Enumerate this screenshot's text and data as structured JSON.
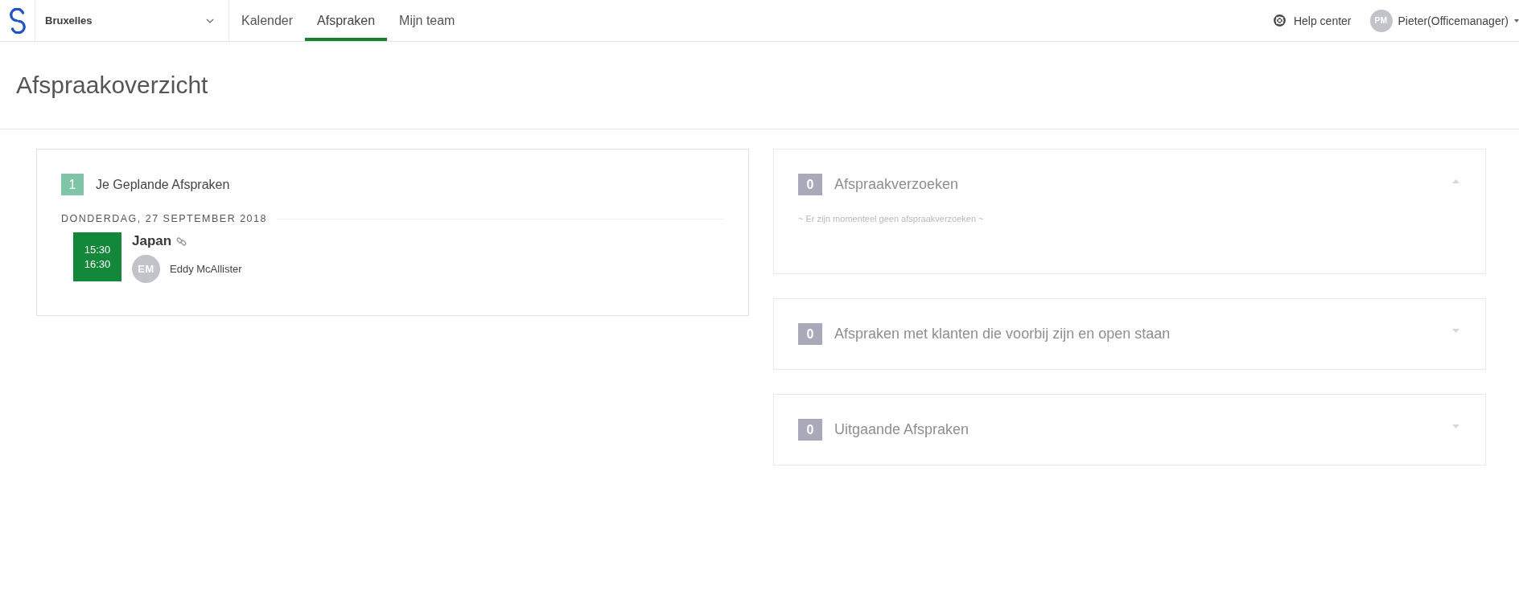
{
  "nav": {
    "location": "Bruxelles",
    "tabs": [
      {
        "label": "Kalender",
        "selected": false
      },
      {
        "label": "Afspraken",
        "selected": true
      },
      {
        "label": "Mijn team",
        "selected": false
      }
    ],
    "help": "Help center",
    "user": {
      "initials": "PM",
      "name": "Pieter(Officemanager)"
    }
  },
  "page_title": "Afspraakoverzicht",
  "planned": {
    "count": "1",
    "title": "Je Geplande Afspraken",
    "days": [
      {
        "date": "DONDERDAG, 27 SEPTEMBER 2018",
        "appointments": [
          {
            "start": "15:30",
            "end": "16:30",
            "title": "Japan",
            "attendee": {
              "initials": "EM",
              "name": "Eddy McAllister"
            }
          }
        ]
      }
    ]
  },
  "sections": [
    {
      "count": "0",
      "title": "Afspraakverzoeken",
      "expanded": true,
      "empty_message": "~ Er zijn momenteel geen afspraakverzoeken ~"
    },
    {
      "count": "0",
      "title": "Afspraken met klanten die voorbij zijn en open staan",
      "expanded": false
    },
    {
      "count": "0",
      "title": "Uitgaande Afspraken",
      "expanded": false
    }
  ]
}
